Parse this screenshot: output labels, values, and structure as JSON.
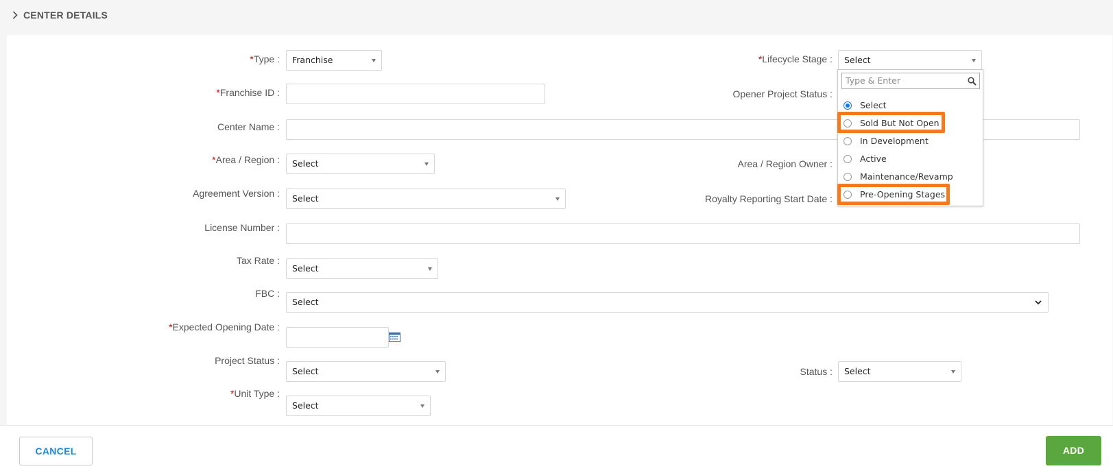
{
  "section": {
    "title": "CENTER DETAILS"
  },
  "fields": {
    "type": {
      "label": "Type :",
      "value": "Franchise"
    },
    "franchise_id": {
      "label": "Franchise ID :",
      "value": ""
    },
    "center_name": {
      "label": "Center Name :",
      "value": ""
    },
    "area_region": {
      "label": "Area / Region :",
      "value": "Select"
    },
    "agreement_version": {
      "label": "Agreement Version :",
      "value": "Select"
    },
    "license_number": {
      "label": "License Number :",
      "value": ""
    },
    "tax_rate": {
      "label": "Tax Rate :",
      "value": "Select"
    },
    "fbc": {
      "label": "FBC :",
      "value": "Select"
    },
    "expected_opening_date": {
      "label": "Expected Opening Date :",
      "value": ""
    },
    "project_status": {
      "label": "Project Status :",
      "value": "Select"
    },
    "unit_type": {
      "label": "Unit Type :",
      "value": "Select"
    },
    "lifecycle_stage": {
      "label": "Lifecycle Stage :",
      "value": "Select"
    },
    "opener_project_status": {
      "label": "Opener Project Status :"
    },
    "area_region_owner": {
      "label": "Area / Region Owner :"
    },
    "royalty_reporting_start_date": {
      "label": "Royalty Reporting Start Date :"
    },
    "status": {
      "label": "Status :",
      "value": "Select"
    }
  },
  "required_marker": "*",
  "lifecycle_dropdown": {
    "search_placeholder": "Type & Enter",
    "options": [
      "Select",
      "Sold But Not Open",
      "In Development",
      "Active",
      "Maintenance/Revamp",
      "Pre-Opening Stages"
    ],
    "selected": "Select",
    "highlighted": [
      "Sold But Not Open",
      "Pre-Opening Stages"
    ],
    "highlight_color": "#f47a20"
  },
  "buttons": {
    "cancel": "CANCEL",
    "add": "ADD"
  },
  "colors": {
    "required": "#cc0000",
    "add_button": "#5aa63f",
    "cancel_text": "#1a8ad4",
    "radio_selected": "#1a73e8"
  }
}
